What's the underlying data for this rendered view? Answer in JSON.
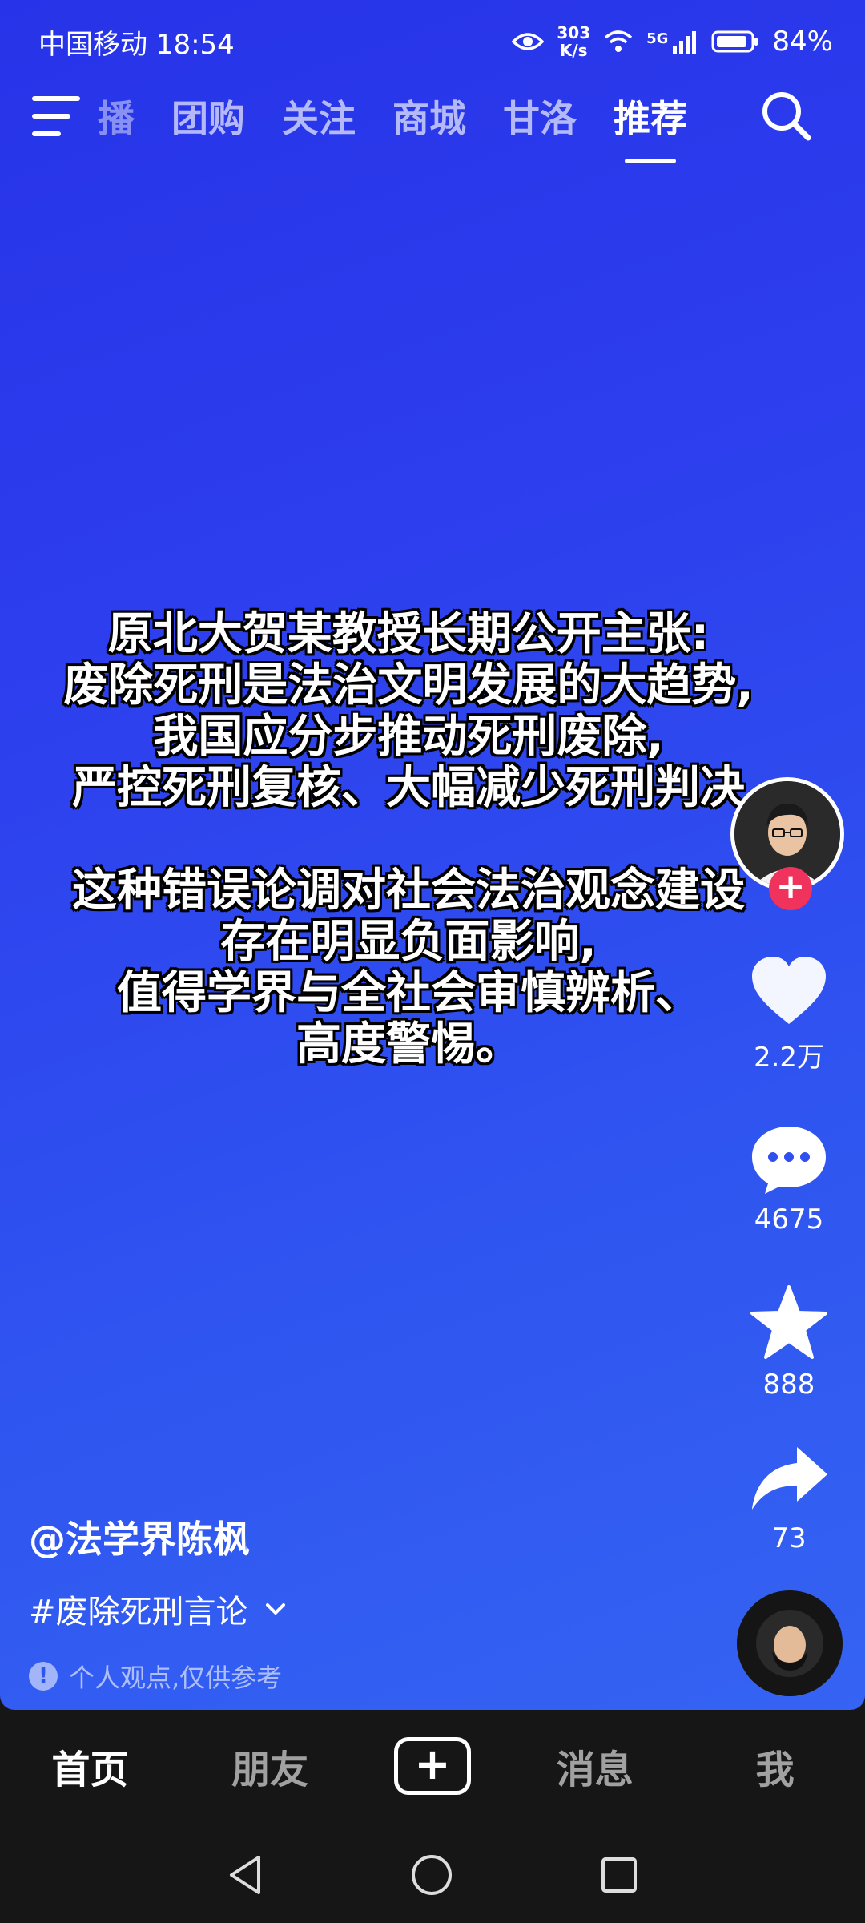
{
  "status_bar": {
    "carrier_time": "中国移动 18:54",
    "speed_value": "303",
    "speed_unit": "K/s",
    "network": "5G",
    "battery": "84%"
  },
  "top_tabs": [
    {
      "label": "播"
    },
    {
      "label": "团购"
    },
    {
      "label": "关注"
    },
    {
      "label": "商城"
    },
    {
      "label": "甘洛"
    },
    {
      "label": "推荐"
    }
  ],
  "overlay_text": {
    "line1": "原北大贺某教授长期公开主张:",
    "line2": "废除死刑是法治文明发展的大趋势,",
    "line3": "我国应分步推动死刑废除,",
    "line4": "严控死刑复核、大幅减少死刑判决",
    "line5": "这种错误论调对社会法治观念建设",
    "line6": "存在明显负面影响,",
    "line7": "值得学界与全社会审慎辨析、",
    "line8": "高度警惕。"
  },
  "actions": {
    "likes": "2.2万",
    "comments": "4675",
    "favorites": "888",
    "shares": "73"
  },
  "caption": {
    "author": "@法学界陈枫",
    "hashtag": "#废除死刑言论",
    "disclaimer": "个人观点,仅供参考"
  },
  "bottom_nav": {
    "home": "首页",
    "friends": "朋友",
    "messages": "消息",
    "me": "我"
  },
  "colors": {
    "background_top": "#2733e8",
    "background_bottom": "#3563f3",
    "follow_button": "#f0335c"
  }
}
